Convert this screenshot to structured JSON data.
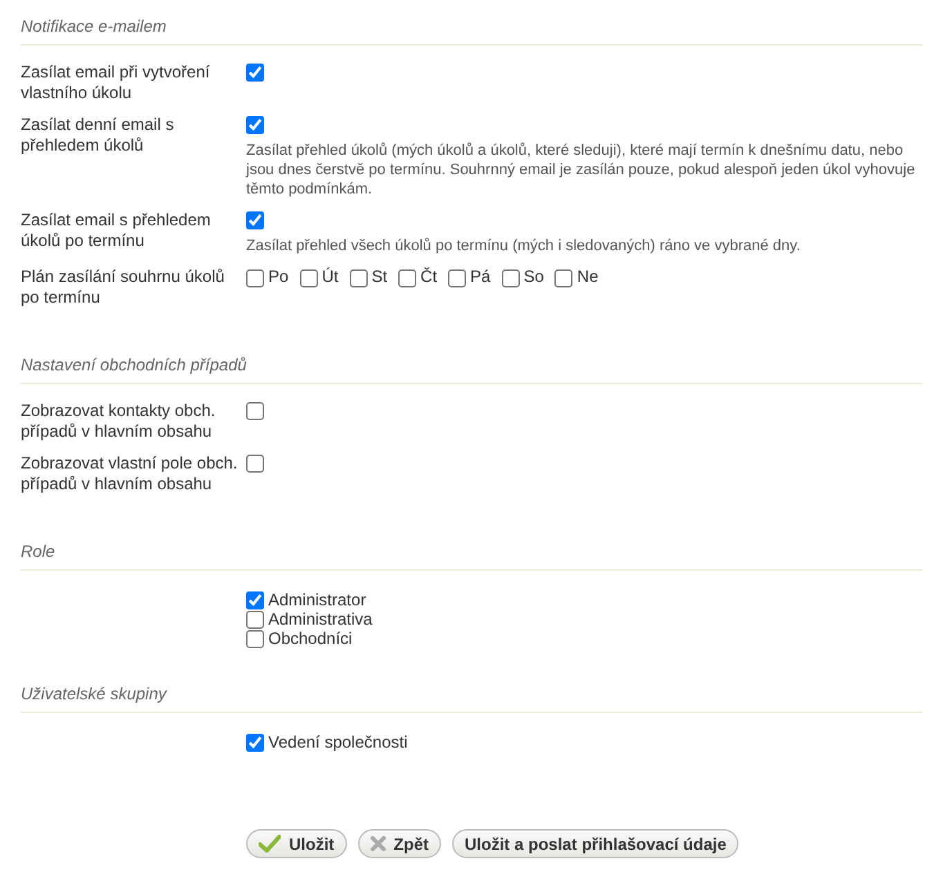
{
  "sections": [
    {
      "title": "Notifikace e-mailem",
      "kind": "settings",
      "rows": [
        {
          "kind": "checkbox",
          "label": "Zasílat email při vytvoření vlastního úkolu",
          "checked": true
        },
        {
          "kind": "checkbox",
          "label": "Zasílat denní email s přehledem úkolů",
          "checked": true,
          "note": "Zasílat přehled úkolů (mých úkolů a úkolů, které sleduji), které mají termín k dnešnímu datu, nebo jsou dnes čerstvě po termínu. Souhrnný email je zasílán pouze, pokud alespoň jeden úkol vyhovuje těmto podmínkám."
        },
        {
          "kind": "checkbox",
          "label": "Zasílat email s přehledem úkolů po termínu",
          "checked": true,
          "note": "Zasílat přehled všech úkolů po termínu (mých i sledovaných) ráno ve vybrané dny."
        },
        {
          "kind": "days",
          "label": "Plán zasílání souhrnu úkolů po termínu",
          "days": [
            {
              "label": "Po",
              "checked": false
            },
            {
              "label": "Út",
              "checked": false
            },
            {
              "label": "St",
              "checked": false
            },
            {
              "label": "Čt",
              "checked": false
            },
            {
              "label": "Pá",
              "checked": false
            },
            {
              "label": "So",
              "checked": false
            },
            {
              "label": "Ne",
              "checked": false
            }
          ]
        }
      ]
    },
    {
      "title": "Nastavení obchodních případů",
      "kind": "settings",
      "rows": [
        {
          "kind": "checkbox",
          "label": "Zobrazovat kontakty obch. případů v hlavním obsahu",
          "checked": false
        },
        {
          "kind": "checkbox",
          "label": "Zobrazovat vlastní pole obch. případů v hlavním obsahu",
          "checked": false
        }
      ]
    },
    {
      "title": "Role",
      "kind": "list",
      "items": [
        {
          "label": "Administrator",
          "checked": true
        },
        {
          "label": "Administrativa",
          "checked": false
        },
        {
          "label": "Obchodníci",
          "checked": false
        }
      ]
    },
    {
      "title": "Uživatelské skupiny",
      "kind": "list",
      "items": [
        {
          "label": "Vedení společnosti",
          "checked": true
        }
      ]
    }
  ],
  "buttons": [
    {
      "label": "Uložit",
      "kind": "check"
    },
    {
      "label": "Zpět",
      "kind": "cross"
    },
    {
      "label": "Uložit a poslat přihlašovací údaje",
      "kind": "plain"
    }
  ]
}
